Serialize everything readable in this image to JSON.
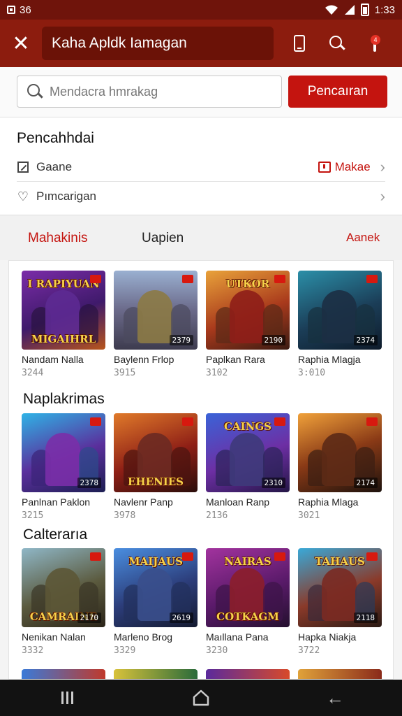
{
  "status_bar": {
    "left_text": "36",
    "time": "1:33"
  },
  "app_bar": {
    "title": "Kaha Apldk Iamagan"
  },
  "search": {
    "placeholder": "Mendacra hmrakag",
    "button_label": "Pencaıran"
  },
  "categories": {
    "title": "Pencahhdai",
    "items": [
      {
        "label": "Gaane",
        "badge": "Makae"
      },
      {
        "label": "Pımcarigan"
      }
    ]
  },
  "tabs": [
    {
      "label": "Mahakinis",
      "active": true
    },
    {
      "label": "Uapien",
      "active": false
    },
    {
      "label": "Aanek",
      "active": false
    }
  ],
  "sections": [
    {
      "title": "",
      "cards": [
        {
          "name": "Nandam Nalla",
          "number": "3244",
          "thumb_count": "",
          "logo_top": "I RAPIYUAN",
          "logo_bottom": "MIGAIHRL"
        },
        {
          "name": "Baylenn Frlop",
          "number": "3915",
          "thumb_count": "2379",
          "logo_top": "",
          "logo_bottom": ""
        },
        {
          "name": "Paplkan Rara",
          "number": "3102",
          "thumb_count": "2190",
          "logo_top": "UTKOR",
          "logo_bottom": ""
        },
        {
          "name": "Raphia Mlagja",
          "number": "3:010",
          "thumb_count": "2374",
          "logo_top": "",
          "logo_bottom": ""
        }
      ]
    },
    {
      "title": "Naplakrimas",
      "cards": [
        {
          "name": "Panlnan Paklon",
          "number": "3215",
          "thumb_count": "2378",
          "logo_top": "",
          "logo_bottom": ""
        },
        {
          "name": "Navlenr Panp",
          "number": "3978",
          "thumb_count": "",
          "logo_top": "",
          "logo_bottom": "EHENIES"
        },
        {
          "name": "Manloan Ranp",
          "number": "2136",
          "thumb_count": "2310",
          "logo_top": "CAINGS",
          "logo_bottom": ""
        },
        {
          "name": "Raphia Mlaga",
          "number": "3021",
          "thumb_count": "2174",
          "logo_top": "",
          "logo_bottom": ""
        }
      ]
    },
    {
      "title": "Calterarıa",
      "cards": [
        {
          "name": "Nenikan Nalan",
          "number": "3332",
          "thumb_count": "2170",
          "logo_top": "",
          "logo_bottom": "CAMRAINE"
        },
        {
          "name": "Marleno Brog",
          "number": "3329",
          "thumb_count": "2619",
          "logo_top": "MAIJAUS",
          "logo_bottom": ""
        },
        {
          "name": "Maıllana Pana",
          "number": "3230",
          "thumb_count": "",
          "logo_top": "NAIRAS",
          "logo_bottom": "COTKAGM"
        },
        {
          "name": "Hapka Niakja",
          "number": "3722",
          "thumb_count": "2118",
          "logo_top": "TAHAUS",
          "logo_bottom": ""
        }
      ]
    }
  ],
  "colors": {
    "primary": "#8c1c0e",
    "accent": "#c4140f",
    "status_bar": "#6f140b"
  },
  "icons": {
    "close": "close-icon",
    "device": "phone-icon",
    "search": "search-icon",
    "notification": "notification-icon"
  }
}
